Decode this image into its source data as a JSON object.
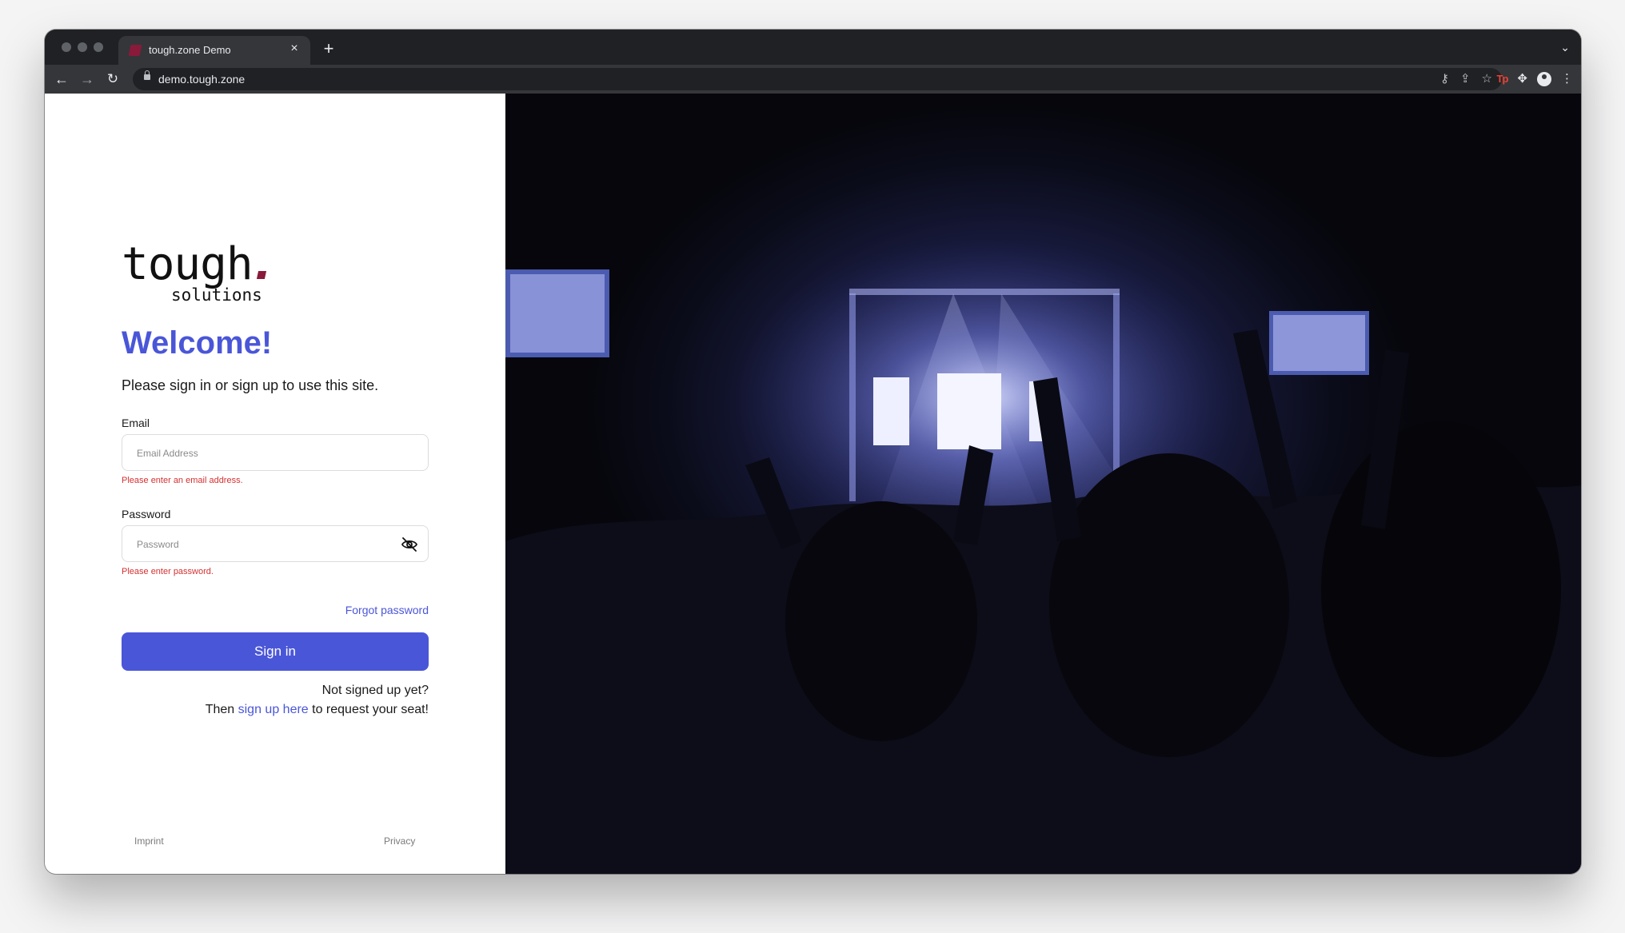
{
  "browser": {
    "tab_title": "tough.zone Demo",
    "tab_close": "×",
    "new_tab": "+",
    "tab_search": "⌄",
    "url": "demo.tough.zone",
    "extension_label": "Tp",
    "icons": [
      "back-icon",
      "forward-icon",
      "reload-icon",
      "lock-icon",
      "key-icon",
      "share-icon",
      "star-icon",
      "extensions-icon",
      "profile-icon",
      "menu-icon"
    ]
  },
  "logo": {
    "word": "tough",
    "sub": "solutions",
    "accent_color": "#8a1a3a"
  },
  "login": {
    "heading": "Welcome!",
    "subtitle": "Please sign in or sign up to use this site.",
    "email_label": "Email",
    "email_placeholder": "Email Address",
    "email_value": "",
    "email_error": "Please enter an email address.",
    "password_label": "Password",
    "password_placeholder": "Password",
    "password_value": "",
    "password_error": "Please enter password.",
    "forgot_password": "Forgot password",
    "sign_in": "Sign in",
    "not_signed_up": "Not signed up yet?",
    "then": "Then",
    "sign_up_link": "sign up here",
    "request_seat": "to request your seat!"
  },
  "footer": {
    "imprint": "Imprint",
    "privacy": "Privacy"
  },
  "colors": {
    "primary": "#4a56d8",
    "error": "#d63030",
    "browser_chrome": "#35363a"
  }
}
